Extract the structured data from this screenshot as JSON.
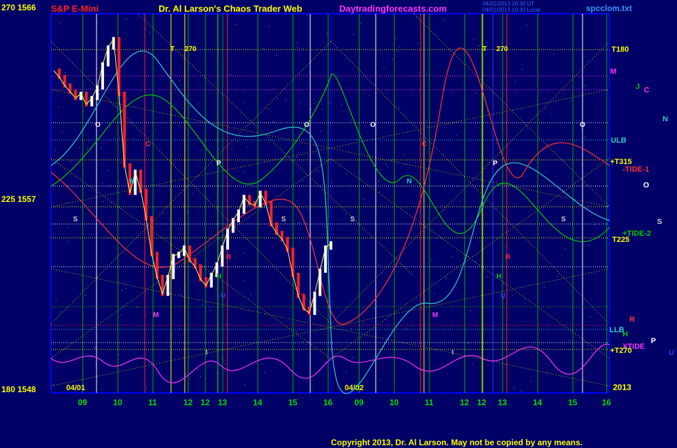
{
  "header": {
    "left_title": "S&P E-Mini",
    "center_title": "Dr. Al Larson's Chaos Trader Web",
    "site": "Daytradingforecasts.com",
    "timestamp_line1": "04/01/2013 20:30 UT",
    "timestamp_line2": "04/01/2013 16:30 Local",
    "file": "spcclom.txt"
  },
  "y_labels": {
    "top": "270  1566",
    "mid": "225  1557",
    "bottom": "180  1548"
  },
  "copyright": "Copyright 2013, Dr. Al Larson. May not be copied by any means.",
  "colors": {
    "background": "#000066",
    "plot_border": "#0000ff",
    "price_up": "#ffffff",
    "price_down": "#ff0000",
    "yellow": "#ffff00",
    "green": "#00cc00",
    "cyan": "#33cccc",
    "magenta": "#ff33ff"
  },
  "chart_data": {
    "type": "line",
    "title": "S&P E-Mini",
    "y_axis": {
      "top_label": "270  1566",
      "mid_label": "225  1557",
      "bottom_label": "180  1548",
      "ylim": [
        1548,
        1566
      ]
    },
    "x_ticks": [
      "09",
      "10",
      "11",
      "12",
      "12",
      "13",
      "14",
      "15",
      "16",
      "09",
      "10",
      "11",
      "12",
      "12",
      "13",
      "14",
      "15",
      "16"
    ],
    "date_labels": [
      "04/01",
      "04/02",
      "2013"
    ],
    "grid": true,
    "price_close_series": [
      1563.3,
      1563.0,
      1562.6,
      1562.3,
      1562.0,
      1562.2,
      1561.7,
      1562.0,
      1562.5,
      1563.6,
      1564.4,
      1564.8,
      1562.2,
      1558.8,
      1557.5,
      1558.5,
      1557.6,
      1556.3,
      1554.6,
      1553.5,
      1552.7,
      1553.5,
      1554.5,
      1554.6,
      1554.9,
      1554.3,
      1554.0,
      1553.4,
      1553.1,
      1553.6,
      1554.1,
      1554.9,
      1555.7,
      1556.2,
      1556.6,
      1557.3,
      1557.0,
      1556.9,
      1557.5,
      1557.0,
      1556.0,
      1555.6,
      1555.3,
      1554.8,
      1553.6,
      1552.6,
      1552.0,
      1551.8,
      1552.7,
      1553.8,
      1554.9,
      1555.1
    ],
    "right_side_labels": [
      {
        "text": "T180",
        "color": "#ffff00"
      },
      {
        "text": "M",
        "color": "#ff33ff"
      },
      {
        "text": "J",
        "color": "#00cc00"
      },
      {
        "text": "C",
        "color": "#ff33ff"
      },
      {
        "text": "N",
        "color": "#33cccc"
      },
      {
        "text": "ULB",
        "color": "#33cccc"
      },
      {
        "text": "+T315",
        "color": "#ffff00"
      },
      {
        "text": "-TIDE-1",
        "color": "#ff3333"
      },
      {
        "text": "O",
        "color": "#ffffff"
      },
      {
        "text": "S",
        "color": "#cccccc"
      },
      {
        "text": "+TIDE-2",
        "color": "#00cc00"
      },
      {
        "text": "T225",
        "color": "#ffff00"
      },
      {
        "text": "R",
        "color": "#ff3333"
      },
      {
        "text": "LLB",
        "color": "#33cccc"
      },
      {
        "text": "H",
        "color": "#00cc00"
      },
      {
        "text": "XTIDE",
        "color": "#ff33ff"
      },
      {
        "text": "P",
        "color": "#ffffff"
      },
      {
        "text": "U",
        "color": "#3333ff"
      },
      {
        "text": "+T270",
        "color": "#ffff00"
      }
    ],
    "in_chart_labels": [
      {
        "text": "T",
        "color": "#ffff00"
      },
      {
        "text": "270",
        "color": "#ffff00"
      },
      {
        "text": "T",
        "color": "#ffff00"
      },
      {
        "text": "270",
        "color": "#ffff00"
      },
      {
        "text": "O",
        "color": "#ffffff"
      },
      {
        "text": "O",
        "color": "#ffffff"
      },
      {
        "text": "O",
        "color": "#ffffff"
      },
      {
        "text": "O",
        "color": "#ffffff"
      },
      {
        "text": "C",
        "color": "#ff3333"
      },
      {
        "text": "C",
        "color": "#ff3333"
      },
      {
        "text": "N",
        "color": "#33cccc"
      },
      {
        "text": "N",
        "color": "#33cccc"
      },
      {
        "text": "P",
        "color": "#ffffff"
      },
      {
        "text": "P",
        "color": "#ffffff"
      },
      {
        "text": "S",
        "color": "#cccccc"
      },
      {
        "text": "S",
        "color": "#cccccc"
      },
      {
        "text": "S",
        "color": "#cccccc"
      },
      {
        "text": "S",
        "color": "#cccccc"
      },
      {
        "text": "R",
        "color": "#ff3333"
      },
      {
        "text": "R",
        "color": "#ff3333"
      },
      {
        "text": "H",
        "color": "#00cc00"
      },
      {
        "text": "H",
        "color": "#00cc00"
      },
      {
        "text": "U",
        "color": "#3333ff"
      },
      {
        "text": "U",
        "color": "#3333ff"
      },
      {
        "text": "M",
        "color": "#ff33ff"
      },
      {
        "text": "M",
        "color": "#ff33ff"
      },
      {
        "text": "t",
        "color": "#aaaaaa"
      },
      {
        "text": "t",
        "color": "#aaaaaa"
      }
    ]
  }
}
